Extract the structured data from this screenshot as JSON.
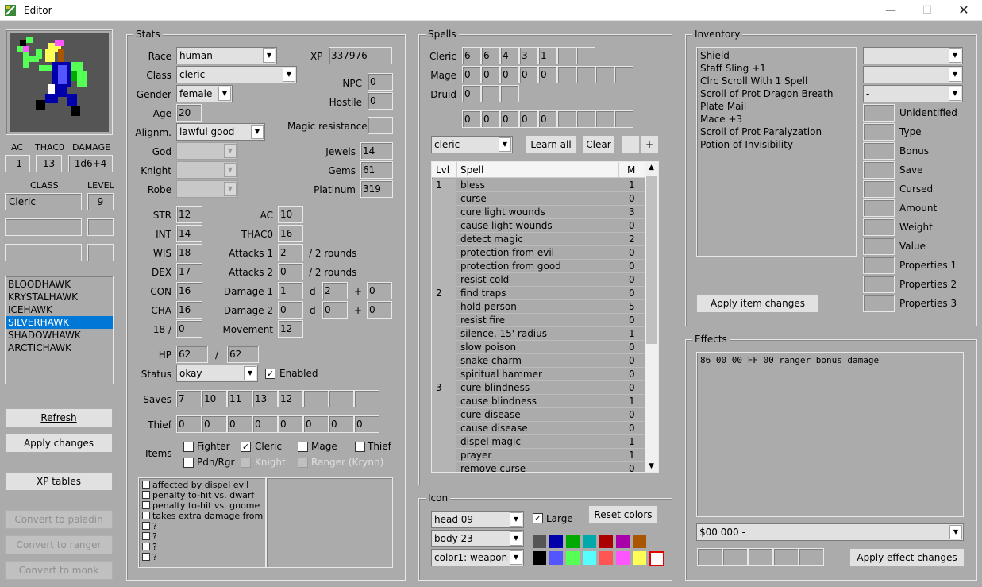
{
  "window": {
    "title": "Editor"
  },
  "portrait": {
    "ac_label": "AC",
    "thac0_label": "THAC0",
    "damage_label": "DAMAGE",
    "ac": "-1",
    "thac0": "13",
    "damage": "1d6+4",
    "class_label": "CLASS",
    "level_label": "LEVEL",
    "class": "Cleric",
    "level": "9"
  },
  "party": [
    "BLOODHAWK",
    "KRYSTALHAWK",
    "ICEHAWK",
    "SILVERHAWK",
    "SHADOWHAWK",
    "ARCTICHAWK"
  ],
  "party_selected": 3,
  "left_buttons": {
    "refresh": "Refresh",
    "apply": "Apply changes",
    "xp": "XP tables",
    "paladin": "Convert to paladin",
    "ranger": "Convert to ranger",
    "monk": "Convert to monk"
  },
  "stats": {
    "title": "Stats",
    "race_label": "Race",
    "race": "human",
    "xp_label": "XP",
    "xp": "337976",
    "class_label": "Class",
    "class": "cleric",
    "npc_label": "NPC",
    "npc": "0",
    "gender_label": "Gender",
    "gender": "female",
    "hostile_label": "Hostile",
    "hostile": "0",
    "age_label": "Age",
    "age": "20",
    "align_label": "Alignm.",
    "align": "lawful good",
    "mr_label": "Magic resistance",
    "mr": "",
    "god_label": "God",
    "jewels_label": "Jewels",
    "jewels": "14",
    "knight_label": "Knight",
    "gems_label": "Gems",
    "gems": "61",
    "robe_label": "Robe",
    "platinum_label": "Platinum",
    "platinum": "319",
    "str_label": "STR",
    "str": "12",
    "ac_label": "AC",
    "ac": "10",
    "int_label": "INT",
    "int": "14",
    "thac0_label": "THAC0",
    "thac0": "16",
    "wis_label": "WIS",
    "wis": "18",
    "att1_label": "Attacks 1",
    "att1": "2",
    "rounds1": "/ 2 rounds",
    "dex_label": "DEX",
    "dex": "17",
    "att2_label": "Attacks 2",
    "att2": "0",
    "rounds2": "/ 2 rounds",
    "con_label": "CON",
    "con": "16",
    "dmg1_label": "Damage 1",
    "dmg1_n": "1",
    "dmg1_d": "2",
    "dmg1_p": "0",
    "cha_label": "CHA",
    "cha": "16",
    "dmg2_label": "Damage 2",
    "dmg2_n": "0",
    "dmg2_d": "0",
    "dmg2_p": "0",
    "exstr_label": "18 /",
    "exstr": "0",
    "move_label": "Movement",
    "move": "12",
    "d": "d",
    "plus": "+",
    "hp_label": "HP",
    "hp": "62",
    "hp_sep": "/",
    "hp_max": "62",
    "status_label": "Status",
    "status": "okay",
    "enabled_label": "Enabled",
    "enabled": true,
    "saves_label": "Saves",
    "saves": [
      "7",
      "10",
      "11",
      "13",
      "12",
      "",
      "",
      " "
    ],
    "thief_label": "Thief",
    "thief": [
      "0",
      "0",
      "0",
      "0",
      "0",
      "0",
      "0",
      "0"
    ],
    "items_label": "Items",
    "items": {
      "fighter": "Fighter",
      "cleric": "Cleric",
      "mage": "Mage",
      "thief": "Thief",
      "pdnrgr": "Pdn/Rgr",
      "knight": "Knight",
      "ranger": "Ranger (Krynn)"
    },
    "effects_list": [
      "affected by dispel evil",
      "penalty to-hit vs. dwarf",
      "penalty to-hit vs. gnome",
      "takes extra damage from ran",
      "?",
      "?",
      "?",
      "?"
    ]
  },
  "spells": {
    "title": "Spells",
    "cleric_label": "Cleric",
    "cleric": [
      "6",
      "6",
      "4",
      "3",
      "1",
      "",
      ""
    ],
    "mage_label": "Mage",
    "mage": [
      "0",
      "0",
      "0",
      "0",
      "0",
      "",
      "",
      "",
      " "
    ],
    "druid_label": "Druid",
    "druid": [
      "0",
      "",
      ""
    ],
    "extra": [
      "0",
      "0",
      "0",
      "0",
      "0",
      "",
      "",
      "",
      " "
    ],
    "class_select": "cleric",
    "learn_all": "Learn all",
    "clear": "Clear",
    "minus": "-",
    "plus": "+",
    "col_lvl": "Lvl",
    "col_spell": "Spell",
    "col_m": "M",
    "rows": [
      {
        "lvl": "1",
        "name": "bless",
        "m": "1"
      },
      {
        "lvl": "",
        "name": "curse",
        "m": "0"
      },
      {
        "lvl": "",
        "name": "cure light wounds",
        "m": "3"
      },
      {
        "lvl": "",
        "name": "cause light wounds",
        "m": "0"
      },
      {
        "lvl": "",
        "name": "detect magic",
        "m": "2"
      },
      {
        "lvl": "",
        "name": "protection from evil",
        "m": "0"
      },
      {
        "lvl": "",
        "name": "protection from good",
        "m": "0"
      },
      {
        "lvl": "",
        "name": "resist cold",
        "m": "0"
      },
      {
        "lvl": "2",
        "name": "find traps",
        "m": "0"
      },
      {
        "lvl": "",
        "name": "hold person",
        "m": "5"
      },
      {
        "lvl": "",
        "name": "resist fire",
        "m": "0"
      },
      {
        "lvl": "",
        "name": "silence, 15' radius",
        "m": "1"
      },
      {
        "lvl": "",
        "name": "slow poison",
        "m": "0"
      },
      {
        "lvl": "",
        "name": "snake charm",
        "m": "0"
      },
      {
        "lvl": "",
        "name": "spiritual hammer",
        "m": "0"
      },
      {
        "lvl": "3",
        "name": "cure blindness",
        "m": "0"
      },
      {
        "lvl": "",
        "name": "cause blindness",
        "m": "1"
      },
      {
        "lvl": "",
        "name": "cure disease",
        "m": "0"
      },
      {
        "lvl": "",
        "name": "cause disease",
        "m": "0"
      },
      {
        "lvl": "",
        "name": "dispel magic",
        "m": "1"
      },
      {
        "lvl": "",
        "name": "prayer",
        "m": "1"
      },
      {
        "lvl": "",
        "name": "remove curse",
        "m": "0"
      }
    ]
  },
  "icon": {
    "title": "Icon",
    "head": "head 09",
    "body": "body 23",
    "color": "color1: weapon",
    "large_label": "Large",
    "large": true,
    "reset": "Reset colors",
    "palette": [
      "#555555",
      "#0000aa",
      "#00aa00",
      "#00aaaa",
      "#aa0000",
      "#aa00aa",
      "#aa5500",
      "#000000",
      "#5555ff",
      "#55ff55",
      "#55ffff",
      "#ff5555",
      "#ff55ff",
      "#ffff55",
      "#ffffff"
    ]
  },
  "inventory": {
    "title": "Inventory",
    "items": [
      "Shield",
      "Staff Sling +1",
      "Clrc Scroll With 1 Spell",
      "Scroll of Prot Dragon Breath",
      "Plate Mail",
      "Mace +3",
      "Scroll of Prot Paralyzation",
      "Potion of Invisibility"
    ],
    "sel1": "-",
    "sel2": "-",
    "sel3": "-",
    "props": [
      "Unidentified",
      "Type",
      "Bonus",
      "Save",
      "Cursed",
      "Amount",
      "Weight",
      "Value",
      "Properties 1",
      "Properties 2",
      "Properties 3"
    ],
    "apply": "Apply item changes"
  },
  "effects": {
    "title": "Effects",
    "text": "86 00 00 FF 00   ranger bonus damage",
    "select": "$00 000 -",
    "apply": "Apply effect changes"
  }
}
